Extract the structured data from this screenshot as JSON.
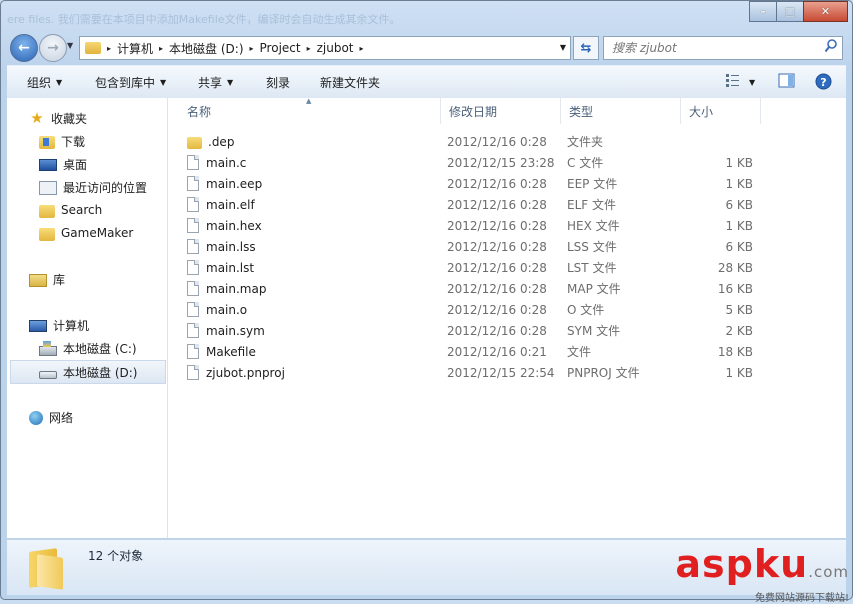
{
  "window": {
    "bg_caption": "ere files. 我们需要在本项目中添加Makefile文件，编译时会自动生成其余文件。",
    "controls": {
      "minimize": "–",
      "maximize": "□",
      "close": "✕"
    }
  },
  "address": {
    "segments": [
      "计算机",
      "本地磁盘 (D:)",
      "Project",
      "zjubot"
    ],
    "separator": "▸"
  },
  "search": {
    "placeholder": "搜索 zjubot"
  },
  "toolbar": {
    "organize": "组织",
    "include_library": "包含到库中",
    "share": "共享",
    "burn": "刻录",
    "new_folder": "新建文件夹"
  },
  "nav": {
    "favorites": "收藏夹",
    "downloads": "下载",
    "desktop": "桌面",
    "recent": "最近访问的位置",
    "search": "Search",
    "gamemaker": "GameMaker",
    "libraries": "库",
    "computer": "计算机",
    "drive_c": "本地磁盘 (C:)",
    "drive_d": "本地磁盘 (D:)",
    "network": "网络"
  },
  "columns": {
    "name": "名称",
    "date": "修改日期",
    "type": "类型",
    "size": "大小"
  },
  "files": [
    {
      "name": ".dep",
      "date": "2012/12/16 0:28",
      "type": "文件夹",
      "size": "",
      "folder": true
    },
    {
      "name": "main.c",
      "date": "2012/12/15 23:28",
      "type": "C 文件",
      "size": "1 KB"
    },
    {
      "name": "main.eep",
      "date": "2012/12/16 0:28",
      "type": "EEP 文件",
      "size": "1 KB"
    },
    {
      "name": "main.elf",
      "date": "2012/12/16 0:28",
      "type": "ELF 文件",
      "size": "6 KB"
    },
    {
      "name": "main.hex",
      "date": "2012/12/16 0:28",
      "type": "HEX 文件",
      "size": "1 KB"
    },
    {
      "name": "main.lss",
      "date": "2012/12/16 0:28",
      "type": "LSS 文件",
      "size": "6 KB"
    },
    {
      "name": "main.lst",
      "date": "2012/12/16 0:28",
      "type": "LST 文件",
      "size": "28 KB"
    },
    {
      "name": "main.map",
      "date": "2012/12/16 0:28",
      "type": "MAP 文件",
      "size": "16 KB"
    },
    {
      "name": "main.o",
      "date": "2012/12/16 0:28",
      "type": "O 文件",
      "size": "5 KB"
    },
    {
      "name": "main.sym",
      "date": "2012/12/16 0:28",
      "type": "SYM 文件",
      "size": "2 KB"
    },
    {
      "name": "Makefile",
      "date": "2012/12/16 0:21",
      "type": "文件",
      "size": "18 KB"
    },
    {
      "name": "zjubot.pnproj",
      "date": "2012/12/15 22:54",
      "type": "PNPROJ 文件",
      "size": "1 KB"
    }
  ],
  "status": {
    "count": "12 个对象"
  },
  "watermark": {
    "asp": "asp",
    "ku": "ku",
    "com": ".com",
    "tagline": "免费网站源码下载站!"
  }
}
